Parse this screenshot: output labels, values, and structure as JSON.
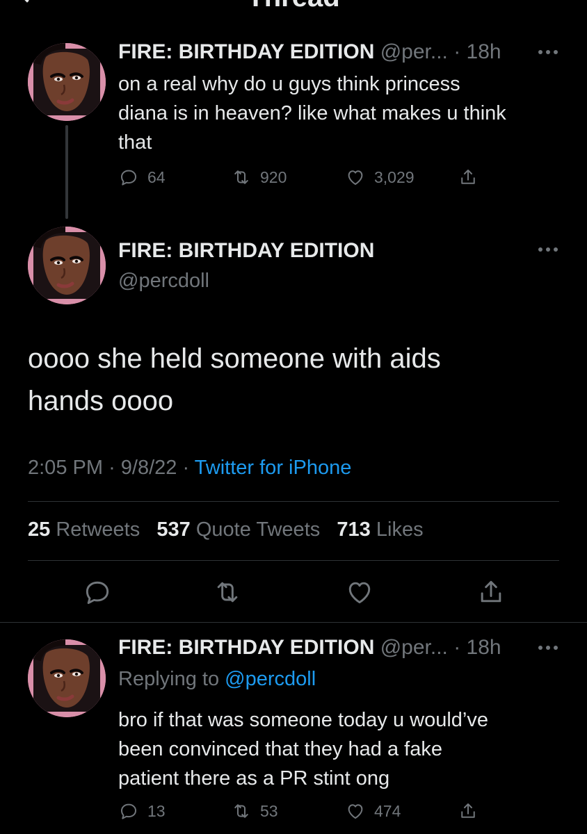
{
  "header": {
    "title": "Thread"
  },
  "parent_tweet": {
    "name": "FIRE: BIRTHDAY EDITION",
    "handle": "@per...",
    "time": "· 18h",
    "text_lines": [
      "on a real why do u guys think princess",
      "diana is in heaven? like what makes u think",
      "that"
    ],
    "replies": "64",
    "retweets": "920",
    "likes": "3,029"
  },
  "main_tweet": {
    "name": "FIRE: BIRTHDAY EDITION",
    "handle": "@percdoll",
    "text_lines": [
      "oooo she held someone with aids",
      "hands oooo"
    ],
    "time": "2:05 PM",
    "date": "· 9/8/22 ·",
    "source": "Twitter for iPhone",
    "retweets_count": "25",
    "retweets_label": "Retweets",
    "quotes_count": "537",
    "quotes_label": "Quote Tweets",
    "likes_count": "713",
    "likes_label": "Likes"
  },
  "reply_tweet": {
    "name": "FIRE: BIRTHDAY EDITION",
    "handle": "@per...",
    "time": "· 18h",
    "replying_prefix": "Replying to",
    "replying_to": "@percdoll",
    "text_lines": [
      "bro if that was someone today u would’ve",
      "been convinced that they had a fake",
      "patient there as a PR stint ong"
    ],
    "replies": "13",
    "retweets": "53",
    "likes": "474"
  },
  "icons": {
    "reply": "reply-icon",
    "retweet": "retweet-icon",
    "like": "heart-icon",
    "share": "share-icon",
    "more": "more-icon"
  },
  "colors": {
    "background": "#000000",
    "text": "#e7e9ea",
    "muted": "#71767b",
    "link": "#1d9bf0",
    "divider": "#2f3336"
  }
}
